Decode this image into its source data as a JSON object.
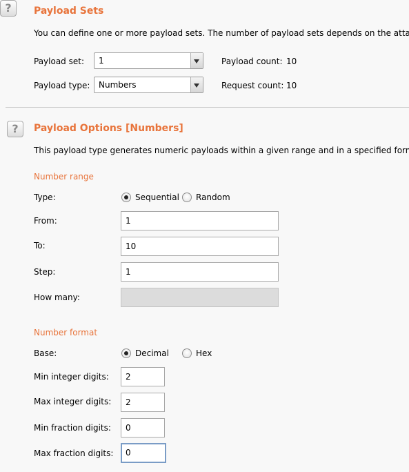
{
  "payload_sets": {
    "title": "Payload Sets",
    "description": "You can define one or more payload sets. The number of payload sets depends on the attack t",
    "set_label": "Payload set:",
    "set_value": "1",
    "type_label": "Payload type:",
    "type_value": "Numbers",
    "payload_count_label": "Payload count:",
    "payload_count": "10",
    "request_count_label": "Request count:",
    "request_count": "10"
  },
  "payload_options": {
    "title": "Payload Options [Numbers]",
    "description": "This payload type generates numeric payloads within a given range and in a specified format.",
    "number_range": {
      "heading": "Number range",
      "type_label": "Type:",
      "sequential_label": "Sequential",
      "random_label": "Random",
      "selected": "Sequential",
      "from_label": "From:",
      "from_value": "1",
      "to_label": "To:",
      "to_value": "10",
      "step_label": "Step:",
      "step_value": "1",
      "how_many_label": "How many:",
      "how_many_value": ""
    },
    "number_format": {
      "heading": "Number format",
      "base_label": "Base:",
      "decimal_label": "Decimal",
      "hex_label": "Hex",
      "selected": "Decimal",
      "min_int_label": "Min integer digits:",
      "min_int_value": "2",
      "max_int_label": "Max integer digits:",
      "max_int_value": "2",
      "min_frac_label": "Min fraction digits:",
      "min_frac_value": "0",
      "max_frac_label": "Max fraction digits:",
      "max_frac_value": "0"
    }
  },
  "icons": {
    "help": "question-mark-icon",
    "dropdown": "chevron-down-icon"
  },
  "colors": {
    "accent": "#e8743b",
    "background": "#f8f8f8",
    "focus": "#7a9cc6"
  }
}
